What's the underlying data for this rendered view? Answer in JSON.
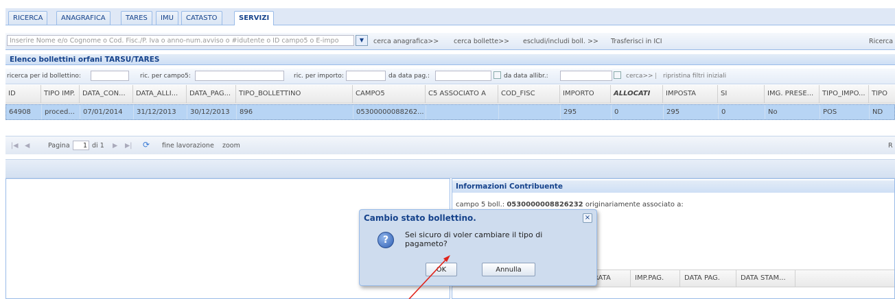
{
  "tabs": [
    {
      "label": "RICERCA"
    },
    {
      "label": "ANAGRAFICA"
    },
    {
      "label": "TARES"
    },
    {
      "label": "IMU"
    },
    {
      "label": "CATASTO"
    },
    {
      "label": "SERVIZI"
    }
  ],
  "toolbar": {
    "search_placeholder": "Inserire Nome e/o Cognome o Cod. Fisc./P. Iva o anno-num.avviso o #idutente o ID campo5 o E-impo",
    "links": [
      "cerca anagrafica>>",
      "cerca bollette>>",
      "escludi/includi boll. >>",
      "Trasferisci in ICI",
      "Ricerca"
    ]
  },
  "panel": {
    "title": "Elenco bollettini orfani TARSU/TARES"
  },
  "filters": {
    "by_id": "ricerca per id bollettino:",
    "by_campo5": "ric. per campo5:",
    "by_importo": "ric. per importo:",
    "da_data_pag": "da data pag.:",
    "da_data_allibr": "da data allibr.:",
    "cerca": "cerca>>",
    "ripristina": "ripristina filtri iniziali",
    "divider": "|"
  },
  "grid": {
    "columns": [
      "ID",
      "TIPO IMP.",
      "DATA_CON...",
      "DATA_ALLI...",
      "DATA_PAG...",
      "TIPO_BOLLETTINO",
      "CAMPO5",
      "C5 ASSOCIATO A",
      "COD_FISC",
      "IMPORTO",
      "ALLOCATI",
      "IMPOSTA",
      "SI",
      "IMG. PRESE...",
      "TIPO_IMPO...",
      "TIPO"
    ],
    "rows": [
      [
        "64908",
        "proced...",
        "07/01/2014",
        "31/12/2013",
        "30/12/2013",
        "896",
        "05300000088262...",
        "",
        "",
        "295",
        "0",
        "295",
        "0",
        "No",
        "POS",
        "ND"
      ]
    ]
  },
  "paging": {
    "page_label": "Pagina",
    "page_value": "1",
    "of_label": "di 1",
    "fine": "fine lavorazione",
    "zoom": "zoom",
    "right_letter": "R"
  },
  "info": {
    "title": "Informazioni Contribuente",
    "campo5_label": "campo 5 boll.:",
    "campo5_value": "0530000008826232",
    "campo5_suffix": "originariamente associato a:",
    "sub_columns": [
      "RATA",
      "IMP.PAG.",
      "DATA PAG.",
      "DATA STAM..."
    ]
  },
  "dialog": {
    "title": "Cambio stato bollettino.",
    "message": "Sei sicuro di voler cambiare il tipo di pagameto?",
    "ok": "OK",
    "cancel": "Annulla",
    "close": "×",
    "icon": "?"
  },
  "colors": {
    "accent": "#15428b",
    "selected_row": "#b7d4f4",
    "arrow": "#e0241b"
  }
}
